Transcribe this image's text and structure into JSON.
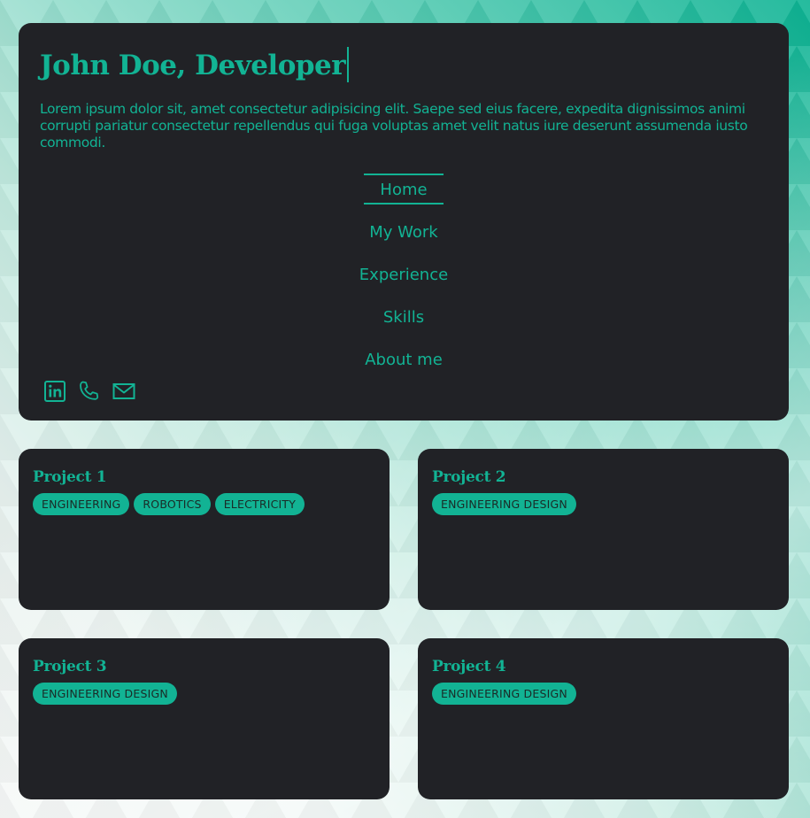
{
  "colors": {
    "accent": "#12b394",
    "panel": "#212226",
    "tag_text": "#1a2b27"
  },
  "header": {
    "title": "John Doe, Developer",
    "intro": "Lorem ipsum dolor sit, amet consectetur adipisicing elit. Saepe sed eius facere, expedita dignissimos animi corrupti pariatur consectetur repellendus qui fuga voluptas amet velit natus iure deserunt assumenda iusto commodi."
  },
  "nav": {
    "items": [
      {
        "label": "Home",
        "active": true
      },
      {
        "label": "My Work",
        "active": false
      },
      {
        "label": "Experience",
        "active": false
      },
      {
        "label": "Skills",
        "active": false
      },
      {
        "label": "About me",
        "active": false
      }
    ]
  },
  "social": {
    "icons": [
      "linkedin-icon",
      "phone-icon",
      "mail-icon"
    ]
  },
  "projects": [
    {
      "title": "Project 1",
      "tags": [
        "ENGINEERING",
        "ROBOTICS",
        "ELECTRICITY"
      ]
    },
    {
      "title": "Project 2",
      "tags": [
        "ENGINEERING DESIGN"
      ]
    },
    {
      "title": "Project 3",
      "tags": [
        "ENGINEERING DESIGN"
      ]
    },
    {
      "title": "Project 4",
      "tags": [
        "ENGINEERING DESIGN"
      ]
    }
  ]
}
